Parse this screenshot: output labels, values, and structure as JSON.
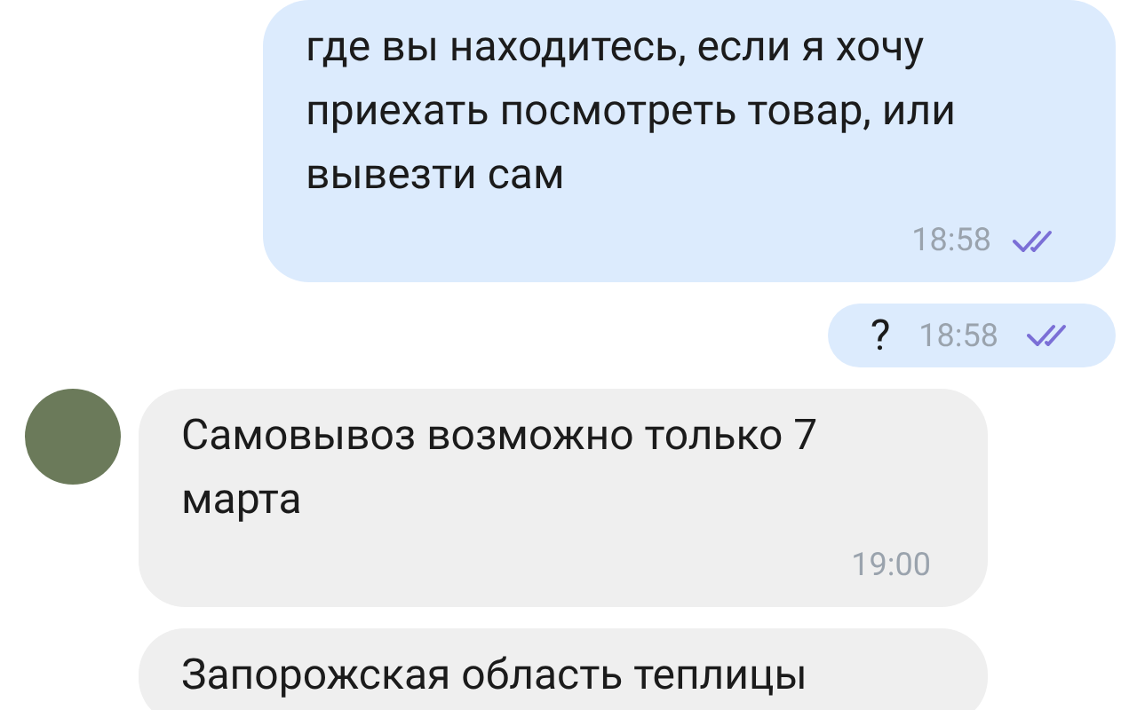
{
  "messages": [
    {
      "kind": "outgoing",
      "lines": [
        "где вы находитесь, если я хочу",
        "приехать посмотреть товар, или",
        "вывезти сам"
      ],
      "time": "18:58",
      "read": true
    },
    {
      "kind": "outgoing",
      "lines": [
        "?"
      ],
      "time": "18:58",
      "read": true
    },
    {
      "kind": "incoming",
      "lines": [
        "Самовывоз возможно только 7",
        "марта"
      ],
      "time": "19:00"
    },
    {
      "kind": "incoming",
      "lines": [
        "Запорожская область теплицы"
      ]
    }
  ]
}
